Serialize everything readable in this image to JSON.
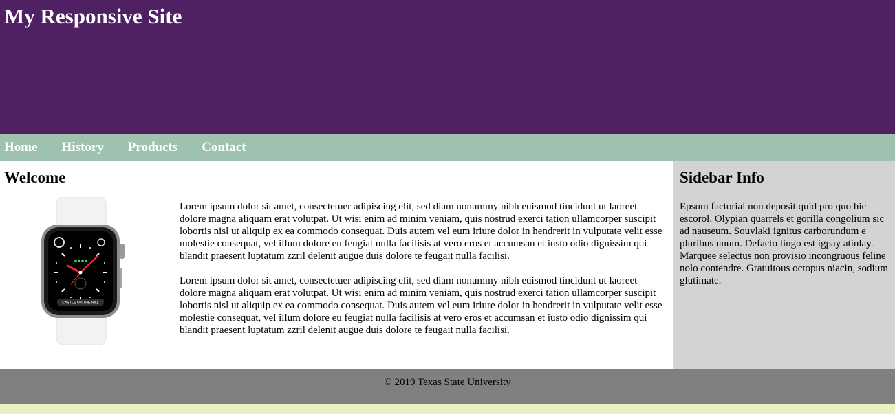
{
  "header": {
    "title": "My Responsive Site"
  },
  "nav": {
    "items": [
      "Home",
      "History",
      "Products",
      "Contact"
    ]
  },
  "main": {
    "heading": "Welcome",
    "watch_label": "CASTLE ON THE HILL",
    "paragraphs": [
      "Lorem ipsum dolor sit amet, consectetuer adipiscing elit, sed diam nonummy nibh euismod tincidunt ut laoreet dolore magna aliquam erat volutpat. Ut wisi enim ad minim veniam, quis nostrud exerci tation ullamcorper suscipit lobortis nisl ut aliquip ex ea commodo consequat. Duis autem vel eum iriure dolor in hendrerit in vulputate velit esse molestie consequat, vel illum dolore eu feugiat nulla facilisis at vero eros et accumsan et iusto odio dignissim qui blandit praesent luptatum zzril delenit augue duis dolore te feugait nulla facilisi.",
      "Lorem ipsum dolor sit amet, consectetuer adipiscing elit, sed diam nonummy nibh euismod tincidunt ut laoreet dolore magna aliquam erat volutpat. Ut wisi enim ad minim veniam, quis nostrud exerci tation ullamcorper suscipit lobortis nisl ut aliquip ex ea commodo consequat. Duis autem vel eum iriure dolor in hendrerit in vulputate velit esse molestie consequat, vel illum dolore eu feugiat nulla facilisis at vero eros et accumsan et iusto odio dignissim qui blandit praesent luptatum zzril delenit augue duis dolore te feugait nulla facilisi."
    ]
  },
  "sidebar": {
    "heading": "Sidebar Info",
    "text": "Epsum factorial non deposit quid pro quo hic escorol. Olypian quarrels et gorilla congolium sic ad nauseum. Souvlaki ignitus carborundum e pluribus unum. Defacto lingo est igpay atinlay. Marquee selectus non provisio incongruous feline nolo contendre. Gratuitous octopus niacin, sodium glutimate."
  },
  "footer": {
    "text": "© 2019 Texas State University"
  },
  "colors": {
    "header_bg": "#4f2163",
    "nav_bg": "#9fc1b0",
    "sidebar_bg": "#d3d3d3",
    "footer_bg": "#808080",
    "page_bg": "#eaf0c3"
  }
}
